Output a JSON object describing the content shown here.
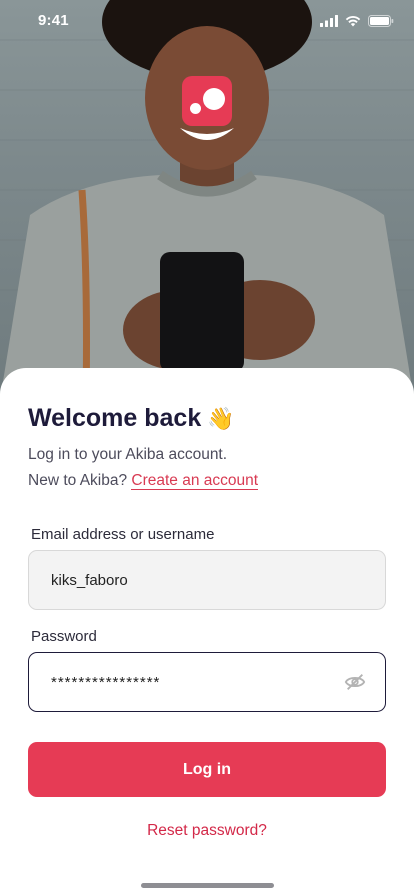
{
  "status_bar": {
    "time": "9:41"
  },
  "hero": {
    "app_logo_icon": "akiba-logo-icon"
  },
  "login": {
    "title": "Welcome back",
    "title_emoji": "👋",
    "subtitle": "Log in to your Akiba account.",
    "new_prompt": "New to Akiba?",
    "create_account_link": "Create an account",
    "email_label": "Email address or username",
    "email_value": "kiks_faboro",
    "password_label": "Password",
    "password_value": "****************",
    "login_button": "Log in",
    "reset_link": "Reset password?"
  },
  "colors": {
    "accent": "#e63b55",
    "heading": "#1e1b3a",
    "link": "#d83a52"
  }
}
